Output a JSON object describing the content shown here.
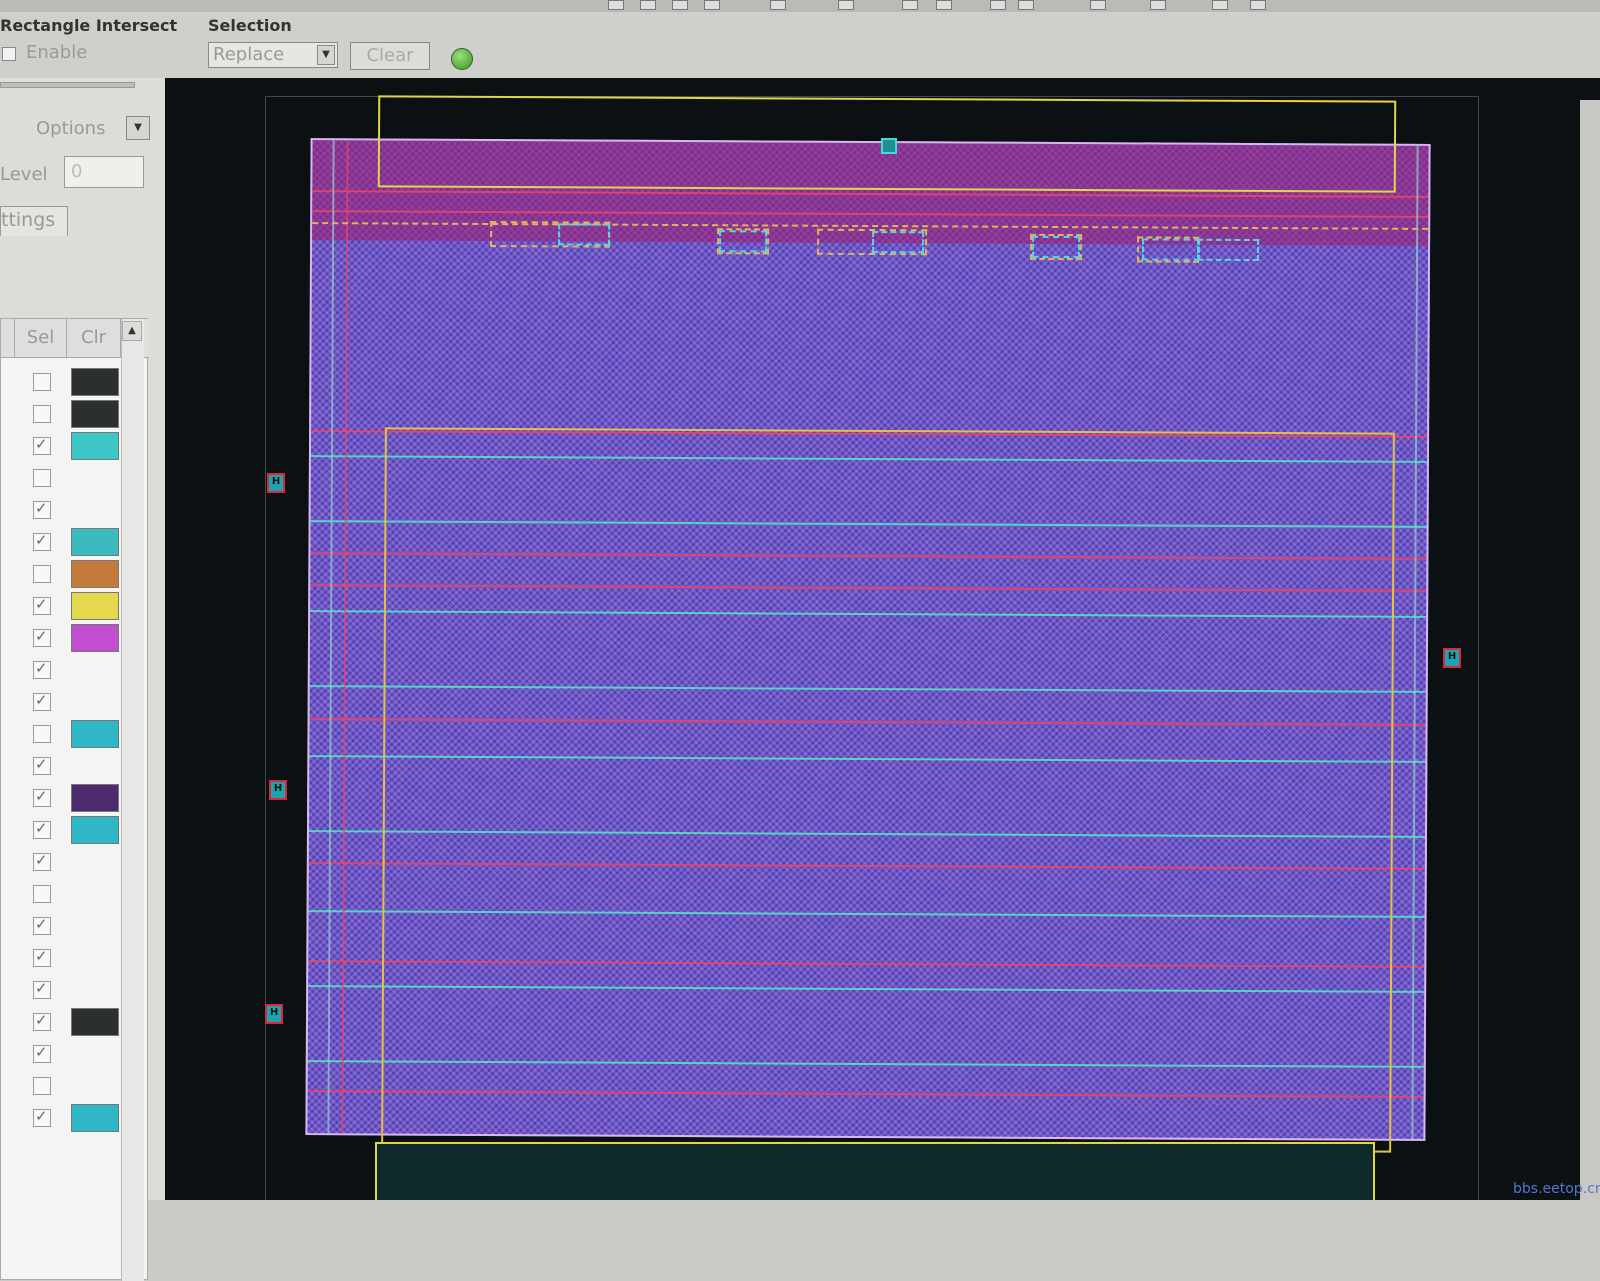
{
  "options": {
    "rect_intersect_label": "Rectangle Intersect",
    "enable_label": "Enable",
    "selection_label": "Selection",
    "selection_mode": "Replace",
    "clear_label": "Clear"
  },
  "left_panel": {
    "options_label": "Options",
    "level_label": "Level",
    "level_value": "0",
    "tab_label": "ttings",
    "columns": [
      "Sel",
      "Clr"
    ]
  },
  "layer_rows": [
    {
      "checked": false,
      "swatch": "#2b2f30"
    },
    {
      "checked": false,
      "swatch": "#2b2f30"
    },
    {
      "checked": true,
      "swatch": "#3dc6c8"
    },
    {
      "checked": false,
      "swatch": ""
    },
    {
      "checked": true,
      "swatch": ""
    },
    {
      "checked": true,
      "swatch": "#3bbac0"
    },
    {
      "checked": false,
      "swatch": "#c47a3b"
    },
    {
      "checked": true,
      "swatch": "#e4d94c"
    },
    {
      "checked": true,
      "swatch": "#c24fd0"
    },
    {
      "checked": true,
      "swatch": ""
    },
    {
      "checked": true,
      "swatch": ""
    },
    {
      "checked": false,
      "swatch": "#2fb7c6"
    },
    {
      "checked": true,
      "swatch": ""
    },
    {
      "checked": true,
      "swatch": "#4d2a6e"
    },
    {
      "checked": true,
      "swatch": "#2fb7c6"
    },
    {
      "checked": true,
      "swatch": ""
    },
    {
      "checked": false,
      "swatch": ""
    },
    {
      "checked": true,
      "swatch": ""
    },
    {
      "checked": true,
      "swatch": ""
    },
    {
      "checked": true,
      "swatch": ""
    },
    {
      "checked": true,
      "swatch": "#2b2f30"
    },
    {
      "checked": true,
      "swatch": ""
    },
    {
      "checked": false,
      "swatch": ""
    },
    {
      "checked": true,
      "swatch": "#2fb7c6"
    }
  ],
  "watermark": "bbs.eetop.cn"
}
